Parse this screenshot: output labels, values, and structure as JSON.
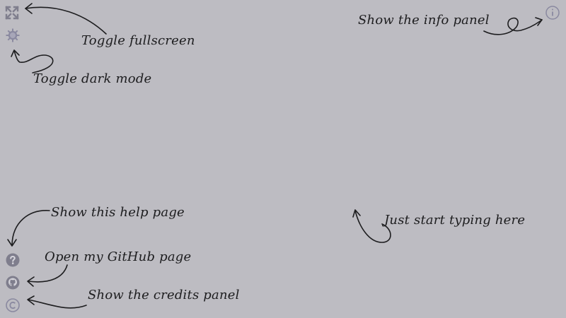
{
  "colors": {
    "background": "#bdbcc2",
    "icon": "#7f7e8d",
    "text": "#1d1d1f"
  },
  "icons": {
    "fullscreen": "expand-icon",
    "dark_mode": "gear-icon",
    "info": "info-icon",
    "help": "help-icon",
    "github": "github-icon",
    "credits": "copyright-icon"
  },
  "hints": {
    "fullscreen": "Toggle fullscreen",
    "dark_mode": "Toggle dark mode",
    "info": "Show the info panel",
    "help": "Show this help page",
    "github": "Open my GitHub page",
    "credits": "Show the credits panel",
    "typing": "Just start typing here"
  }
}
